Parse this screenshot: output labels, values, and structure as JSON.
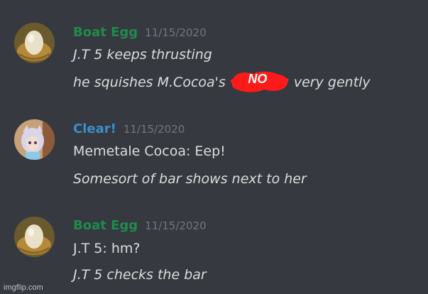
{
  "colors": {
    "background": "#36393f",
    "boat_egg_name": "#1f8b4c",
    "clear_name": "#3b8fcc",
    "timestamp": "#72767d",
    "message_text": "#dcddde",
    "redaction": "#ff1a1a"
  },
  "messages": [
    {
      "username": "Boat Egg",
      "timestamp": "11/15/2020",
      "avatar_icon": "egg-avatar-icon",
      "lines": [
        {
          "text": "J.T 5 keeps thrusting",
          "italic": true
        },
        {
          "before": "he squishes M.Cocoa's",
          "redaction_label": "NO",
          "after": "very gently",
          "italic": true
        }
      ]
    },
    {
      "username": "Clear!",
      "timestamp": "11/15/2020",
      "avatar_icon": "anime-girl-avatar-icon",
      "lines": [
        {
          "text": "Memetale Cocoa: Eep!",
          "italic": false
        },
        {
          "text": "Somesort of bar shows next to her",
          "italic": true
        }
      ]
    },
    {
      "username": "Boat Egg",
      "timestamp": "11/15/2020",
      "avatar_icon": "egg-avatar-icon",
      "lines": [
        {
          "text": "J.T 5: hm?",
          "italic": false
        },
        {
          "text": "J.T 5 checks the bar",
          "italic": true
        }
      ]
    }
  ],
  "watermark": "imgflip.com"
}
